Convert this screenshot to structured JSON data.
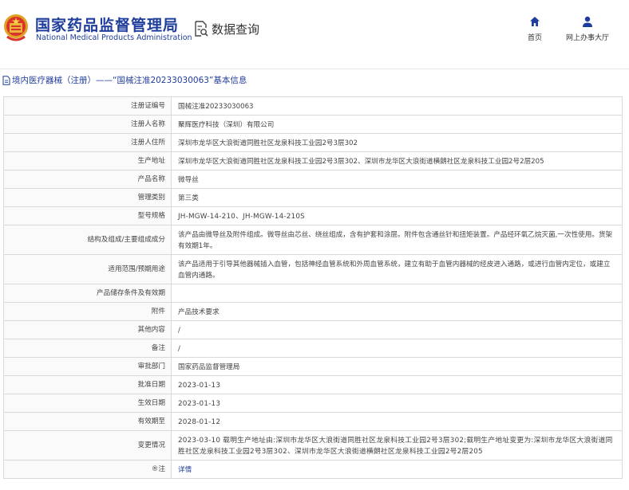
{
  "header": {
    "site_name_cn": "国家药品监督管理局",
    "site_name_en": "National Medical Products Administration",
    "section_title": "数据查询",
    "nav": {
      "home_label": "首页",
      "hall_label": "网上办事大厅"
    }
  },
  "breadcrumb": {
    "text": "境内医疗器械（注册）——“国械注准20233030063”基本信息"
  },
  "details": [
    {
      "label": "注册证编号",
      "value": "国械注准20233030063",
      "numeric": false
    },
    {
      "label": "注册人名称",
      "value": "聚辉医疗科技（深圳）有限公司",
      "numeric": false
    },
    {
      "label": "注册人住所",
      "value": "深圳市龙华区大浪街道同胜社区龙泉科技工业园2号3层302",
      "numeric": false
    },
    {
      "label": "生产地址",
      "value": "深圳市龙华区大浪街道同胜社区龙泉科技工业园2号3层302、深圳市龙华区大浪街道横朗社区龙泉科技工业园2号2层205",
      "numeric": false
    },
    {
      "label": "产品名称",
      "value": "微导丝",
      "numeric": false
    },
    {
      "label": "管理类别",
      "value": "第三类",
      "numeric": false
    },
    {
      "label": "型号规格",
      "value": "JH-MGW-14-210、JH-MGW-14-210S",
      "numeric": true
    },
    {
      "label": "结构及组成/主要组成成分",
      "value": "该产品由微导丝及附件组成。微导丝由芯丝、绕丝组成，含有护套和涂层。附件包含通丝针和扭矩装置。产品经环氧乙烷灭菌,一次性使用。货架有效期1年。",
      "numeric": false,
      "tall": true
    },
    {
      "label": "适用范围/预期用途",
      "value": "该产品适用于引导其他器械插入血管，包括神经血管系统和外周血管系统，建立有助于血管内器械的经皮进入通路，或进行血管内定位，或建立血管内通路。",
      "numeric": false,
      "tall": true
    },
    {
      "label": "产品储存条件及有效期",
      "value": "",
      "numeric": false
    },
    {
      "label": "附件",
      "value": "产品技术要求",
      "numeric": false
    },
    {
      "label": "其他内容",
      "value": "/",
      "numeric": false
    },
    {
      "label": "备注",
      "value": "/",
      "numeric": false
    },
    {
      "label": "审批部门",
      "value": "国家药品监督管理局",
      "numeric": false
    },
    {
      "label": "批准日期",
      "value": "2023-01-13",
      "numeric": true
    },
    {
      "label": "生效日期",
      "value": "2023-01-13",
      "numeric": true
    },
    {
      "label": "有效期至",
      "value": "2028-01-12",
      "numeric": true
    },
    {
      "label": "变更情况",
      "value": "2023-03-10 载明生产地址由:深圳市龙华区大浪街道同胜社区龙泉科技工业园2号3层302;载明生产地址变更为:深圳市龙华区大浪街道同胜社区龙泉科技工业园2号3层302、深圳市龙华区大浪街道横朗社区龙泉科技工业园2号2层205",
      "numeric": true,
      "tall": true
    }
  ],
  "note_row": {
    "marker": "®",
    "label": "注",
    "link": "详情"
  },
  "colors": {
    "brand_blue": "#1f3d9b",
    "border": "#d9d9d9",
    "label_bg": "#fafafa"
  },
  "icons": {
    "logo": "national-emblem-icon",
    "search": "document-search-icon",
    "home": "home-icon",
    "hall": "user-icon",
    "breadcrumb": "document-icon"
  }
}
